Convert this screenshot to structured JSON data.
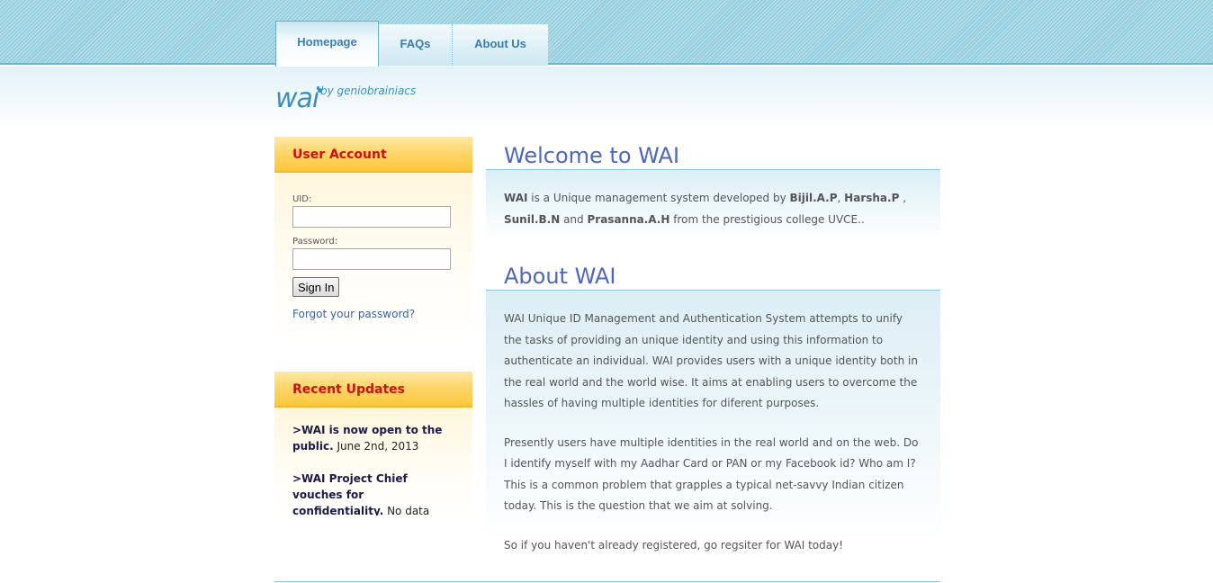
{
  "nav": {
    "tabs": [
      {
        "label": "Homepage"
      },
      {
        "label": "FAQs"
      },
      {
        "label": "About Us"
      }
    ]
  },
  "logo": {
    "name": "wai",
    "byline": "by",
    "author": "geniobrainiacs"
  },
  "user_account": {
    "title": "User Account",
    "uid_label": "UID:",
    "uid_value": "",
    "password_label": "Password:",
    "password_value": "",
    "signin_label": "Sign In",
    "forgot_label": "Forgot your password?"
  },
  "recent_updates": {
    "title": "Recent Updates",
    "items": [
      {
        "headline": ">WAI is now open to the public.",
        "text": " June 2nd, 2013"
      },
      {
        "headline": ">WAI Project Chief vouches for confidentiality.",
        "text": " No data present with WAI will ever be"
      }
    ]
  },
  "welcome": {
    "title": "Welcome to WAI",
    "text_1": "WAI",
    "text_2": " is a Unique management system developed by ",
    "name_1": "Bijil.A.P",
    "sep_1": ", ",
    "name_2": "Harsha.P",
    "sep_2": " , ",
    "name_3": "Sunil.B.N",
    "sep_3": " and ",
    "name_4": "Prasanna.A.H",
    "text_3": " from the prestigious college UVCE.."
  },
  "about": {
    "title": "About WAI",
    "paragraphs": [
      "WAI Unique ID Management and Authentication System attempts to unify the tasks of providing an unique identity and using this information to authenticate an individual. WAI provides users with a unique identity both in the real world and the world wise. It aims at enabling users to overcome the hassles of having multiple identities for diferent purposes.",
      "Presently users have multiple identities in the real world and on the web. Do I identify myself with my Aadhar Card or PAN or my Facebook id? Who am I? This is a common problem that grapples a typical net-savvy Indian citizen today. This is the question that we aim at solving.",
      "So if you haven't already registered, go regsiter for WAI today!"
    ]
  },
  "colors": {
    "accent": "#4f67b8",
    "box_title": "#cc1111",
    "link": "#3b63a0",
    "header": "#9fd5e3"
  }
}
